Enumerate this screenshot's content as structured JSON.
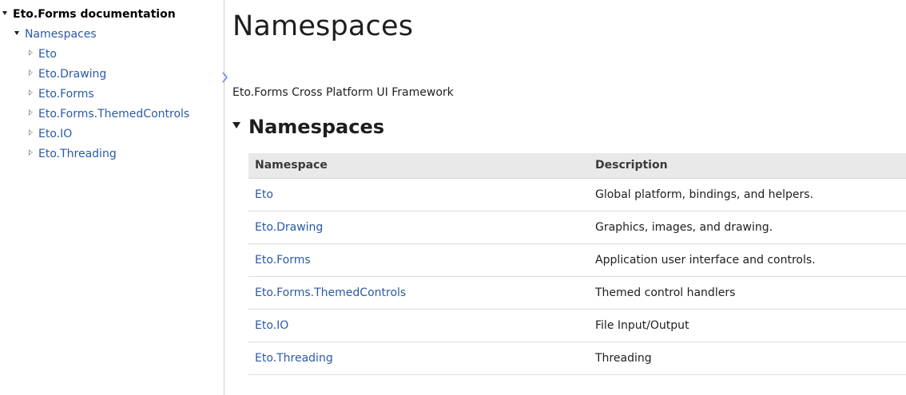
{
  "sidebar": {
    "root_label": "Eto.Forms documentation",
    "namespaces_label": "Namespaces",
    "items": [
      {
        "label": "Eto"
      },
      {
        "label": "Eto.Drawing"
      },
      {
        "label": "Eto.Forms"
      },
      {
        "label": "Eto.Forms.ThemedControls"
      },
      {
        "label": "Eto.IO"
      },
      {
        "label": "Eto.Threading"
      }
    ]
  },
  "main": {
    "title": "Namespaces",
    "summary": "Eto.Forms Cross Platform UI Framework",
    "section_heading": "Namespaces",
    "table": {
      "headers": {
        "namespace": "Namespace",
        "description": "Description"
      },
      "rows": [
        {
          "namespace": "Eto",
          "description": "Global platform, bindings, and helpers."
        },
        {
          "namespace": "Eto.Drawing",
          "description": "Graphics, images, and drawing."
        },
        {
          "namespace": "Eto.Forms",
          "description": "Application user interface and controls."
        },
        {
          "namespace": "Eto.Forms.ThemedControls",
          "description": "Themed control handlers"
        },
        {
          "namespace": "Eto.IO",
          "description": "File Input/Output"
        },
        {
          "namespace": "Eto.Threading",
          "description": "Threading"
        }
      ]
    }
  },
  "colors": {
    "link": "#2a5aa6",
    "header_bg": "#e9e9e9",
    "text": "#1e1e1e"
  },
  "icons": {
    "expanded": "triangle-down-icon",
    "collapsed": "triangle-right-icon"
  }
}
